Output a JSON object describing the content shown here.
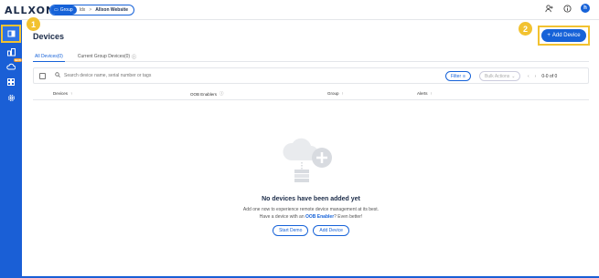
{
  "header": {
    "logo_text": "ALLXON",
    "breadcrumb": {
      "group": "Group",
      "segment": "Idx",
      "separator": ">",
      "current": "Allxon Website"
    },
    "icons": [
      "add-user-icon",
      "help-icon"
    ],
    "avatar_initial": "h"
  },
  "sidebar": {
    "items": [
      {
        "icon": "dashboard-icon",
        "active": true
      },
      {
        "icon": "devices-icon"
      },
      {
        "icon": "cloud-icon",
        "badge": "NEW"
      },
      {
        "icon": "apps-icon"
      },
      {
        "icon": "settings-icon"
      }
    ]
  },
  "steps": {
    "one": "1",
    "two": "2"
  },
  "page": {
    "title": "Devices",
    "add_button": "Add Device",
    "add_button_icon": "+"
  },
  "tabs": [
    {
      "label": "All Devices(0)"
    },
    {
      "label": "Current Group Devices(0)",
      "info": "ⓘ"
    }
  ],
  "toolbar": {
    "search_placeholder": "Search device name, serial number or tags",
    "filter_label": "Filter",
    "bulk_label": "Bulk Actions",
    "pager_text": "0-0 of 0"
  },
  "table": {
    "columns": [
      {
        "label": "Devices",
        "icon": "↑"
      },
      {
        "label": "OOB Enablers",
        "icon": "ⓘ"
      },
      {
        "label": "Group",
        "icon": "↑"
      },
      {
        "label": "Alerts",
        "icon": "↑"
      }
    ]
  },
  "empty": {
    "title": "No devices have been added yet",
    "line1": "Add one now to experience remote device management at its best.",
    "line2_pre": "Have a device with an ",
    "line2_link": "OOB Enabler",
    "line2_post": "? Even better!",
    "start_demo": "Start Demo",
    "add_device": "Add Device"
  },
  "colors": {
    "brand": "#1a5fd6",
    "highlight": "#f2c230",
    "title": "#1b2b48"
  }
}
